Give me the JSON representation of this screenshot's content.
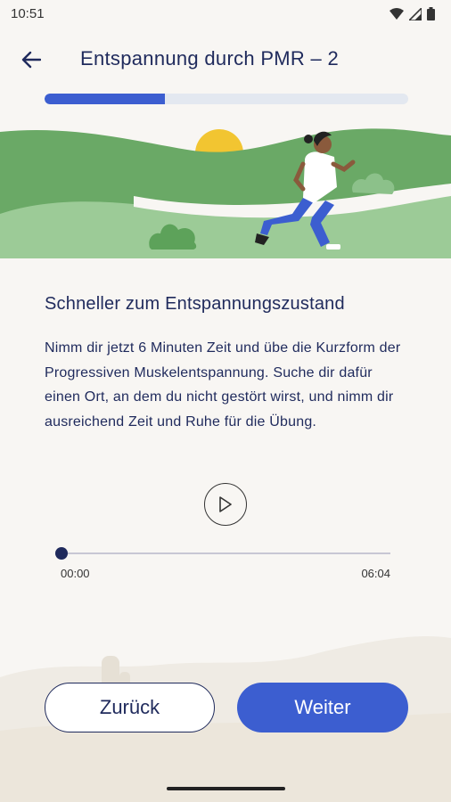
{
  "status_bar": {
    "time": "10:51"
  },
  "header": {
    "title": "Entspannung durch PMR – 2"
  },
  "progress": {
    "fraction": 0.33
  },
  "content": {
    "heading": "Schneller zum Entspannungszustand",
    "body": "Nimm dir jetzt 6 Minuten Zeit und übe die Kurzform der Progressiven Muskelentspannung. Suche dir dafür einen Ort, an dem du nicht gestört wirst, und nimm dir ausreichend Zeit und Ruhe für die Übung."
  },
  "player": {
    "current_time": "00:00",
    "duration": "06:04",
    "position_fraction": 0
  },
  "buttons": {
    "back_label": "Zurück",
    "next_label": "Weiter"
  },
  "colors": {
    "accent": "#3c5ed0",
    "text": "#1f2a5c",
    "hill_light": "#8cc18a",
    "hill_dark": "#5da25a",
    "sun": "#f2c531"
  },
  "icons": {
    "back": "arrow-left-icon",
    "play": "play-icon",
    "wifi": "wifi-icon",
    "signal": "signal-icon",
    "battery": "battery-icon"
  }
}
